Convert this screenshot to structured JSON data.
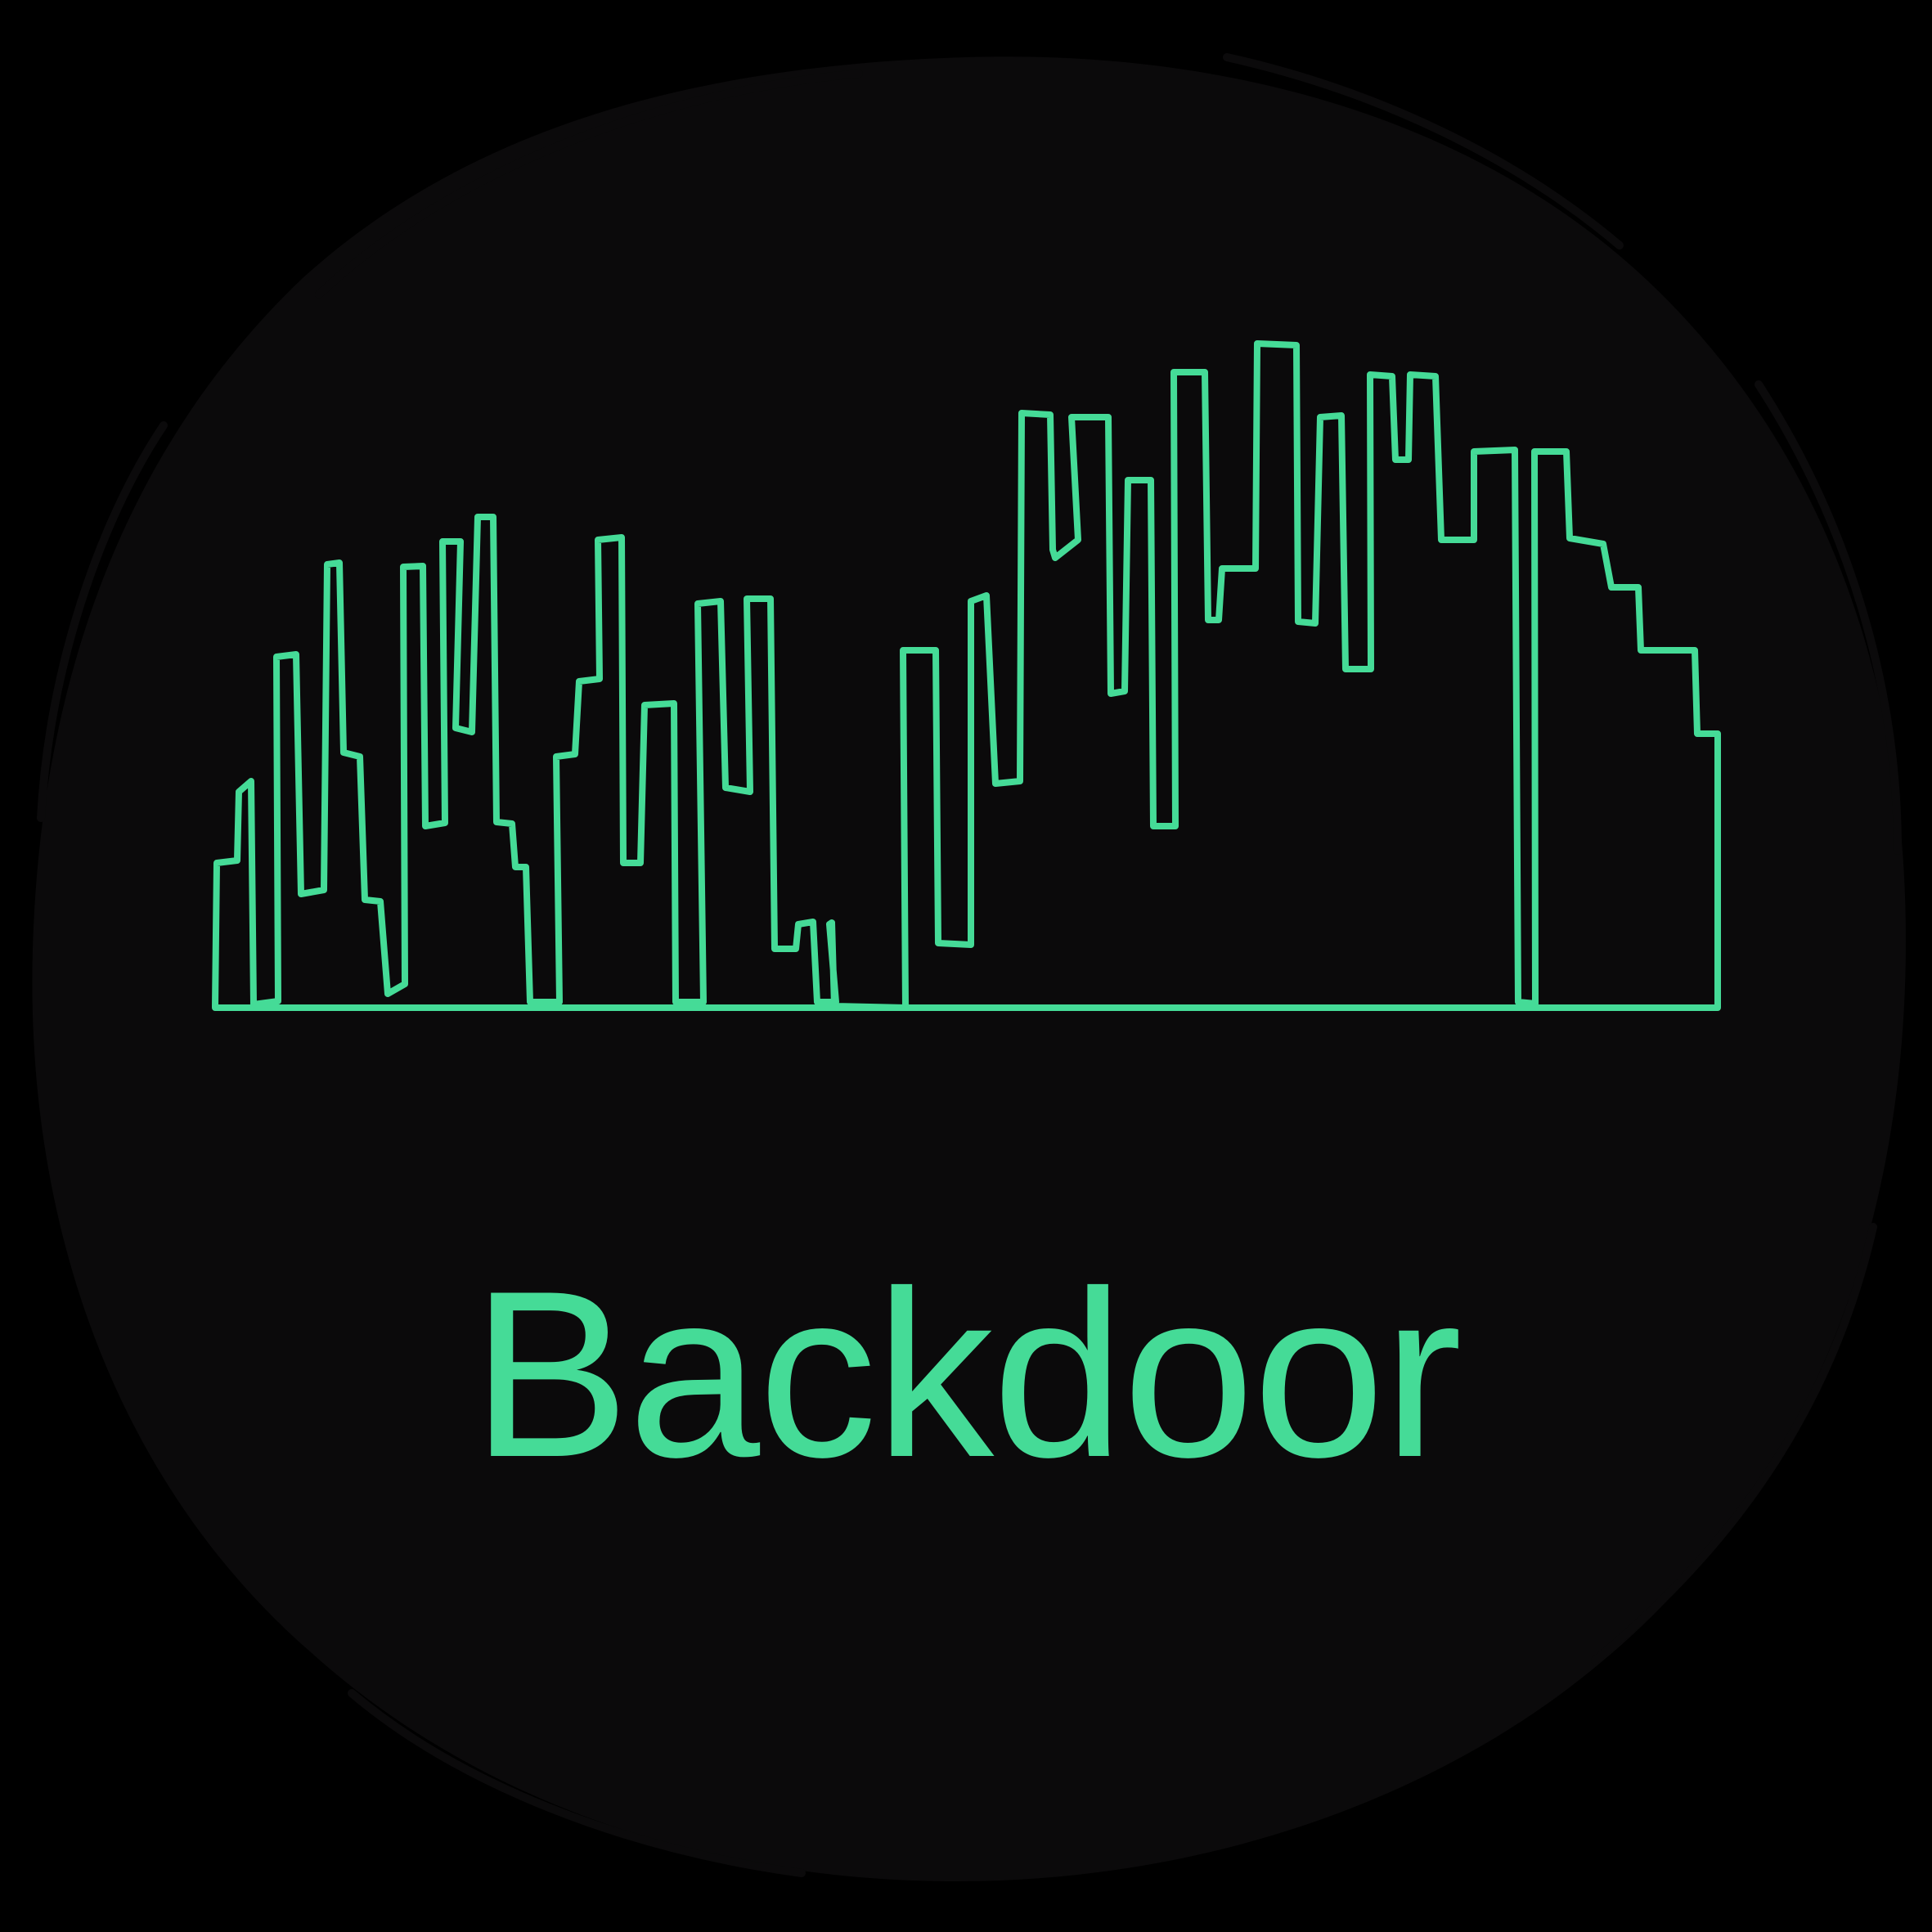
{
  "logo": {
    "wordmark": "Backdoor",
    "skyline_label": "city-skyline-outline"
  },
  "colors": {
    "page_background": "#000000",
    "badge_fill": "#0b0a0b",
    "accent_green": "#45db97"
  }
}
